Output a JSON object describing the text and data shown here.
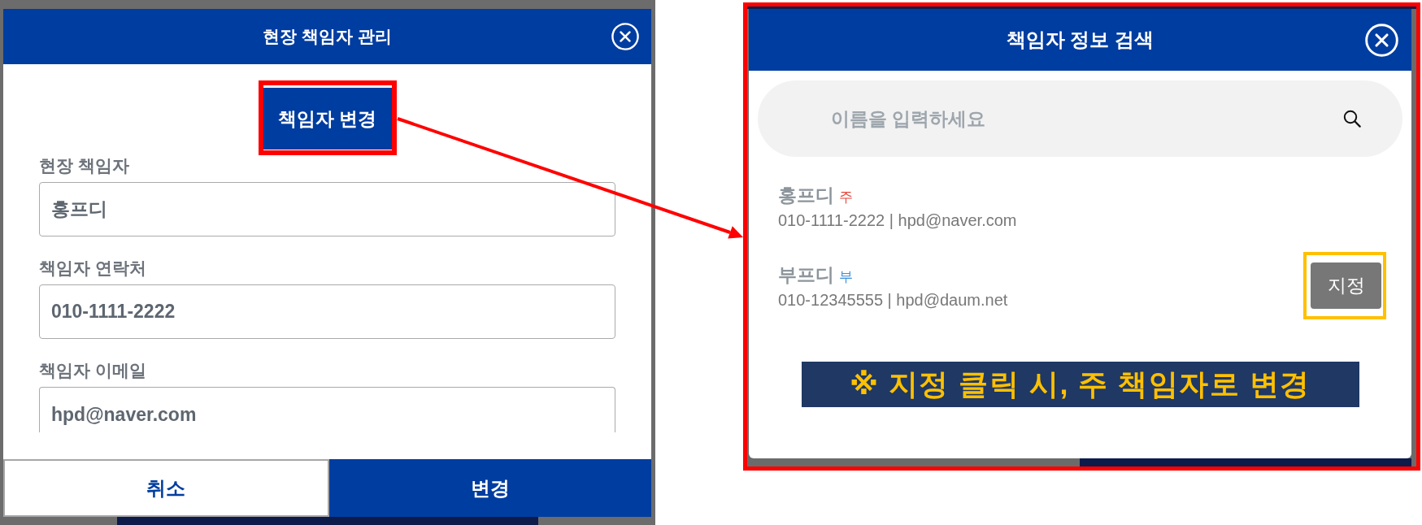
{
  "manage_dialog": {
    "title": "현장 책임자 관리",
    "change_person_button": {
      "label": "책임자 변경",
      "highlighted": true
    },
    "fields": [
      {
        "label": "현장 책임자",
        "value": "홍프디"
      },
      {
        "label": "책임자 연락처",
        "value": "010-1111-2222"
      },
      {
        "label": "책임자 이메일",
        "value": "hpd@naver.com"
      }
    ],
    "buttons": [
      {
        "label": "취소",
        "kind": "secondary"
      },
      {
        "label": "변경",
        "kind": "primary"
      }
    ]
  },
  "search_dialog": {
    "title": "책임자 정보 검색",
    "highlighted": true,
    "search": {
      "placeholder": "이름을 입력하세요"
    },
    "people": [
      {
        "name": "홍프디",
        "role": "주",
        "color": "#e0483e",
        "details": "010-1111-2222 | hpd@naver.com"
      },
      {
        "name": "부프디",
        "role": "부",
        "color": "#3b8fd8",
        "details": "010-12345555 | hpd@daum.net",
        "assign_button": {
          "label": "지정",
          "highlighted": true
        }
      }
    ],
    "note": "※ 지정 클릭 시, 주 책임자로 변경"
  }
}
